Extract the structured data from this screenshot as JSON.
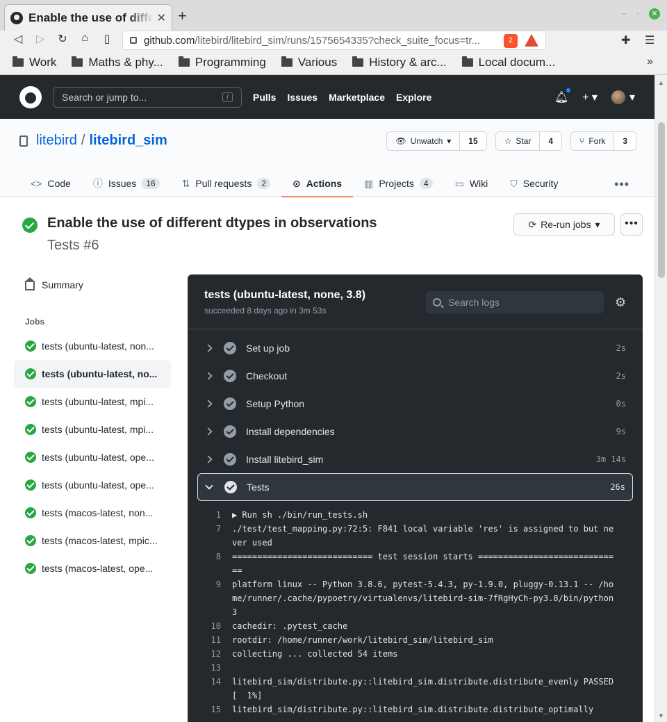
{
  "browser": {
    "tab_title": "Enable the use of different dtypes in observations",
    "url_host": "github.com",
    "url_rest": "/litebird/litebird_sim/runs/1575654335?check_suite_focus=tr...",
    "brave_badge": "2",
    "bookmarks": [
      "Work",
      "Maths & phy...",
      "Programming",
      "Various",
      "History & arc...",
      "Local docum..."
    ]
  },
  "gh": {
    "search_placeholder": "Search or jump to...",
    "search_key": "/",
    "nav": [
      "Pulls",
      "Issues",
      "Marketplace",
      "Explore"
    ]
  },
  "repo": {
    "owner": "litebird",
    "sep": "/",
    "name": "litebird_sim",
    "unwatch": "Unwatch",
    "unwatch_count": "15",
    "star": "Star",
    "star_count": "4",
    "fork": "Fork",
    "fork_count": "3",
    "tabs": {
      "code": "Code",
      "issues": "Issues",
      "issues_count": "16",
      "pulls": "Pull requests",
      "pulls_count": "2",
      "actions": "Actions",
      "projects": "Projects",
      "projects_count": "4",
      "wiki": "Wiki",
      "security": "Security"
    }
  },
  "run": {
    "title": "Enable the use of different dtypes in observations",
    "subtitle": "Tests #6",
    "rerun": "Re-run jobs"
  },
  "sidebar": {
    "summary": "Summary",
    "jobs_heading": "Jobs",
    "jobs": [
      "tests (ubuntu-latest, non...",
      "tests (ubuntu-latest, no...",
      "tests (ubuntu-latest, mpi...",
      "tests (ubuntu-latest, mpi...",
      "tests (ubuntu-latest, ope...",
      "tests (ubuntu-latest, ope...",
      "tests (macos-latest, non...",
      "tests (macos-latest, mpic...",
      "tests (macos-latest, ope..."
    ]
  },
  "log": {
    "title": "tests (ubuntu-latest, none, 3.8)",
    "subtitle": "succeeded 8 days ago in 3m 53s",
    "search_placeholder": "Search logs",
    "steps": [
      {
        "name": "Set up job",
        "dur": "2s"
      },
      {
        "name": "Checkout",
        "dur": "2s"
      },
      {
        "name": "Setup Python",
        "dur": "0s"
      },
      {
        "name": "Install dependencies",
        "dur": "9s"
      },
      {
        "name": "Install litebird_sim",
        "dur": "3m 14s"
      },
      {
        "name": "Tests",
        "dur": "26s"
      }
    ],
    "lines": [
      {
        "n": "1",
        "t": "▶ Run sh ./bin/run_tests.sh"
      },
      {
        "n": "7",
        "t": "./test/test_mapping.py:72:5: F841 local variable 'res' is assigned to but never used"
      },
      {
        "n": "8",
        "t": "============================ test session starts ============================="
      },
      {
        "n": "9",
        "t": "platform linux -- Python 3.8.6, pytest-5.4.3, py-1.9.0, pluggy-0.13.1 -- /home/runner/.cache/pypoetry/virtualenvs/litebird-sim-7fRgHyCh-py3.8/bin/python3"
      },
      {
        "n": "10",
        "t": "cachedir: .pytest_cache"
      },
      {
        "n": "11",
        "t": "rootdir: /home/runner/work/litebird_sim/litebird_sim"
      },
      {
        "n": "12",
        "t": "collecting ... collected 54 items"
      },
      {
        "n": "13",
        "t": ""
      },
      {
        "n": "14",
        "t": "litebird_sim/distribute.py::litebird_sim.distribute.distribute_evenly PASSED [  1%]"
      },
      {
        "n": "15",
        "t": "litebird_sim/distribute.py::litebird_sim.distribute.distribute_optimally"
      }
    ]
  }
}
